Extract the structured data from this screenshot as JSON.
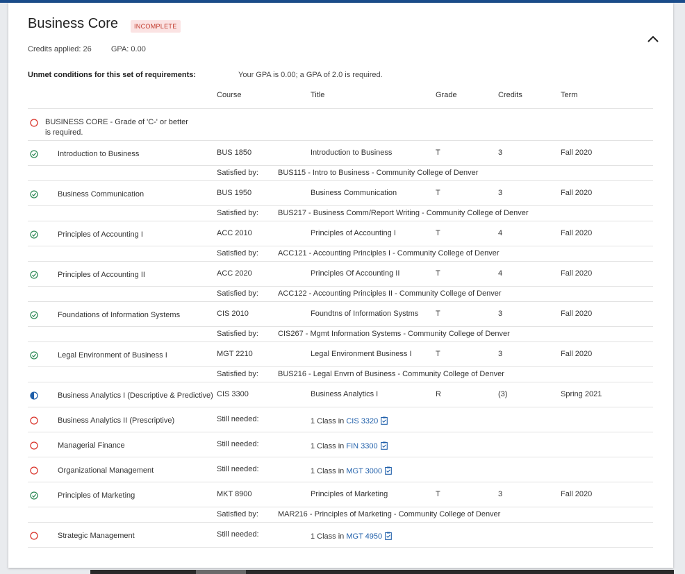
{
  "header": {
    "title": "Business Core",
    "status": "INCOMPLETE",
    "credits_label": "Credits applied:",
    "credits_value": "26",
    "gpa_label": "GPA:",
    "gpa_value": "0.00"
  },
  "unmet": {
    "label": "Unmet conditions for this set of requirements:",
    "text": "Your GPA is 0.00; a GPA of 2.0 is required."
  },
  "columns": {
    "course": "Course",
    "title": "Title",
    "grade": "Grade",
    "credits": "Credits",
    "term": "Term"
  },
  "group_rule": "BUSINESS CORE - Grade of 'C-' or better is required.",
  "satisfied_label": "Satisfied by:",
  "still_needed_label": "Still needed:",
  "colors": {
    "complete": "#2e8b57",
    "incomplete": "#d9342b",
    "in_progress": "#1f5faa",
    "link": "#1f5faa"
  },
  "rows": [
    {
      "status": "complete",
      "name": "Introduction to Business",
      "course": "BUS 1850",
      "title": "Introduction to Business",
      "grade": "T",
      "credits": "3",
      "term": "Fall 2020",
      "satisfied": "BUS115 - Intro to Business - Community College of Denver"
    },
    {
      "status": "complete",
      "name": "Business Communication",
      "course": "BUS 1950",
      "title": "Business Communication",
      "grade": "T",
      "credits": "3",
      "term": "Fall 2020",
      "satisfied": "BUS217 - Business Comm/Report Writing - Community College of Denver"
    },
    {
      "status": "complete",
      "name": "Principles of Accounting I",
      "course": "ACC 2010",
      "title": "Principles of Accounting I",
      "grade": "T",
      "credits": "4",
      "term": "Fall 2020",
      "satisfied": "ACC121 - Accounting Principles I - Community College of Denver"
    },
    {
      "status": "complete",
      "name": "Principles of Accounting II",
      "course": "ACC 2020",
      "title": "Principles Of Accounting II",
      "grade": "T",
      "credits": "4",
      "term": "Fall 2020",
      "satisfied": "ACC122 - Accounting Principles II - Community College of Denver"
    },
    {
      "status": "complete",
      "name": "Foundations of Information Systems",
      "course": "CIS 2010",
      "title": "Foundtns of Information Systms",
      "grade": "T",
      "credits": "3",
      "term": "Fall 2020",
      "satisfied": "CIS267 - Mgmt Information Systems - Community College of Denver"
    },
    {
      "status": "complete",
      "name": "Legal Environment of Business I",
      "course": "MGT 2210",
      "title": "Legal Environment Business I",
      "grade": "T",
      "credits": "3",
      "term": "Fall 2020",
      "satisfied": "BUS216 - Legal Envrn of Business - Community College of Denver"
    },
    {
      "status": "in_progress",
      "name": "Business Analytics I (Descriptive & Predictive)",
      "course": "CIS 3300",
      "title": "Business Analytics I",
      "grade": "R",
      "credits": "(3)",
      "term": "Spring 2021"
    },
    {
      "status": "incomplete",
      "name": "Business Analytics II (Prescriptive)",
      "needed_prefix": "1 Class in",
      "needed_course": "CIS 3320"
    },
    {
      "status": "incomplete",
      "name": "Managerial Finance",
      "needed_prefix": "1 Class in",
      "needed_course": "FIN 3300"
    },
    {
      "status": "incomplete",
      "name": "Organizational Management",
      "needed_prefix": "1 Class in",
      "needed_course": "MGT 3000"
    },
    {
      "status": "complete",
      "name": "Principles of Marketing",
      "course": "MKT 8900",
      "title": "Principles of Marketing",
      "grade": "T",
      "credits": "3",
      "term": "Fall 2020",
      "satisfied": "MAR216 - Principles of Marketing - Community College of Denver"
    },
    {
      "status": "incomplete",
      "name": "Strategic Management",
      "needed_prefix": "1 Class in",
      "needed_course": "MGT 4950"
    }
  ]
}
